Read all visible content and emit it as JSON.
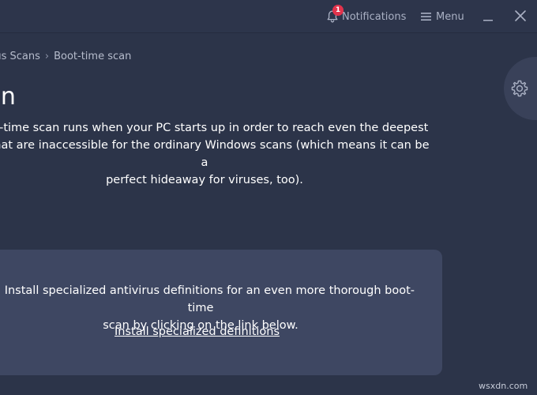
{
  "titlebar": {
    "notifications": {
      "label": "Notifications",
      "badge_count": "1",
      "icon": "bell-icon",
      "badge_color": "#e2334c"
    },
    "menu": {
      "label": "Menu",
      "icon": "hamburger-icon"
    },
    "window_controls": [
      "minimize-icon",
      "close-icon"
    ]
  },
  "breadcrumb": {
    "items": [
      "Virus Scans",
      "Boot-time scan"
    ],
    "visible_first": "rus Scans",
    "separator": "›"
  },
  "settings": {
    "icon": "gear-icon"
  },
  "main": {
    "title": "Boot-time scan",
    "visible_title": "can",
    "description": "oot-time scan runs when your PC starts up in order to reach even the deepest s that are inaccessible for the ordinary Windows scans (which means it can be a perfect hideaway for viruses, too).",
    "description_lines": [
      "oot-time scan runs when your PC starts up in order to reach even the deepest",
      "s that are inaccessible for the ordinary Windows scans (which means it can be a",
      "perfect hideaway for viruses, too)."
    ]
  },
  "card": {
    "tip_lines": [
      "ip: Install specialized antivirus definitions for an even more thorough boot-time",
      "scan by clicking on the link below."
    ],
    "link_label": "Install specialized definitions"
  },
  "watermark": "wsxdn.com",
  "colors": {
    "background": "#2c3449",
    "card": "#3e4762",
    "text": "#ffffff",
    "muted_text": "#aab1c4"
  }
}
